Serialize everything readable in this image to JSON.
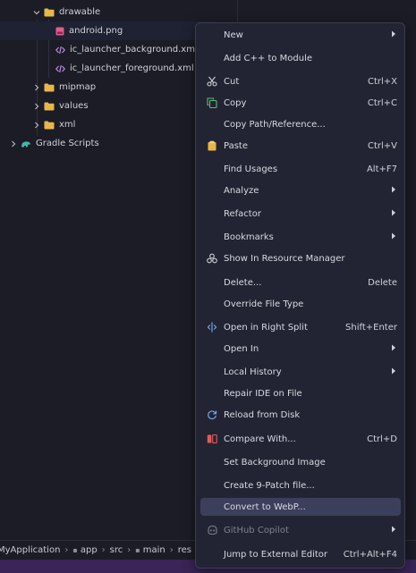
{
  "project_tree": {
    "items": [
      {
        "label": "drawable",
        "type": "folder",
        "expanded": true
      },
      {
        "label": "android.png",
        "type": "png",
        "selected": true
      },
      {
        "label": "ic_launcher_background.xml",
        "type": "xml"
      },
      {
        "label": "ic_launcher_foreground.xml",
        "type": "xml"
      },
      {
        "label": "mipmap",
        "type": "folder",
        "expanded": false
      },
      {
        "label": "values",
        "type": "folder",
        "expanded": false
      },
      {
        "label": "xml",
        "type": "folder",
        "expanded": false
      },
      {
        "label": "Gradle Scripts",
        "type": "gradle",
        "expanded": false
      }
    ]
  },
  "status_bar": {
    "breadcrumbs": [
      "MyApplication",
      "app",
      "src",
      "main",
      "res"
    ]
  },
  "context_menu": {
    "items": [
      {
        "label": "New",
        "shortcut": "",
        "submenu": true,
        "icon": ""
      },
      {
        "label": "Add C++ to Module",
        "shortcut": "",
        "submenu": false,
        "icon": ""
      },
      {
        "label": "Cut",
        "shortcut": "Ctrl+X",
        "submenu": false,
        "icon": "scissors-icon"
      },
      {
        "label": "Copy",
        "shortcut": "Ctrl+C",
        "submenu": false,
        "icon": "copy-icon"
      },
      {
        "label": "Copy Path/Reference...",
        "shortcut": "",
        "submenu": false,
        "icon": ""
      },
      {
        "label": "Paste",
        "shortcut": "Ctrl+V",
        "submenu": false,
        "icon": "clipboard-icon"
      },
      {
        "label": "Find Usages",
        "shortcut": "Alt+F7",
        "submenu": false,
        "icon": ""
      },
      {
        "label": "Analyze",
        "shortcut": "",
        "submenu": true,
        "icon": ""
      },
      {
        "label": "Refactor",
        "shortcut": "",
        "submenu": true,
        "icon": ""
      },
      {
        "label": "Bookmarks",
        "shortcut": "",
        "submenu": true,
        "icon": ""
      },
      {
        "label": "Show In Resource Manager",
        "shortcut": "",
        "submenu": false,
        "icon": "resource-manager-icon"
      },
      {
        "label": "Delete...",
        "shortcut": "Delete",
        "submenu": false,
        "icon": ""
      },
      {
        "label": "Override File Type",
        "shortcut": "",
        "submenu": false,
        "icon": ""
      },
      {
        "label": "Open in Right Split",
        "shortcut": "Shift+Enter",
        "submenu": false,
        "icon": "split-icon"
      },
      {
        "label": "Open In",
        "shortcut": "",
        "submenu": true,
        "icon": ""
      },
      {
        "label": "Local History",
        "shortcut": "",
        "submenu": true,
        "icon": ""
      },
      {
        "label": "Repair IDE on File",
        "shortcut": "",
        "submenu": false,
        "icon": ""
      },
      {
        "label": "Reload from Disk",
        "shortcut": "",
        "submenu": false,
        "icon": "reload-icon"
      },
      {
        "label": "Compare With...",
        "shortcut": "Ctrl+D",
        "submenu": false,
        "icon": "compare-icon"
      },
      {
        "label": "Set Background Image",
        "shortcut": "",
        "submenu": false,
        "icon": ""
      },
      {
        "label": "Create 9-Patch file...",
        "shortcut": "",
        "submenu": false,
        "icon": ""
      },
      {
        "label": "Convert to WebP...",
        "shortcut": "",
        "submenu": false,
        "icon": "",
        "highlighted": true
      },
      {
        "label": "GitHub Copilot",
        "shortcut": "",
        "submenu": true,
        "icon": "copilot-icon",
        "disabled": true
      },
      {
        "label": "Jump to External Editor",
        "shortcut": "Ctrl+Alt+F4",
        "submenu": false,
        "icon": ""
      }
    ]
  },
  "colors": {
    "background": "#1b1c26",
    "menu_background": "#232433",
    "menu_highlight": "#3b3f5c",
    "folder": "#e8b74a",
    "xml_icon": "#b98be0",
    "png_icon": "#e05d8a",
    "gradle_icon": "#3fb9a6",
    "accent": "#6b8cf0",
    "bottom_strip": "#3a2458"
  }
}
